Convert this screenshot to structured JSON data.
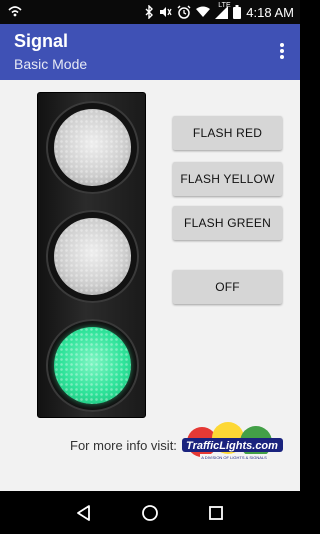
{
  "status_bar": {
    "time": "4:18 AM",
    "network_label": "LTE",
    "icons": [
      "notification-icon",
      "bluetooth-icon",
      "mute-icon",
      "alarm-icon",
      "wifi-icon",
      "cellular-signal-icon",
      "battery-icon"
    ]
  },
  "app_bar": {
    "title": "Signal",
    "subtitle": "Basic Mode",
    "menu_icon": "overflow-menu-icon",
    "color": "#3f51b5"
  },
  "signal": {
    "lamps": [
      {
        "position": "top",
        "state": "off"
      },
      {
        "position": "middle",
        "state": "off"
      },
      {
        "position": "bottom",
        "state": "on",
        "color": "#2fe39a"
      }
    ]
  },
  "buttons": {
    "flash_red": "FLASH RED",
    "flash_yellow": "FLASH YELLOW",
    "flash_green": "FLASH GREEN",
    "off": "OFF"
  },
  "footer": {
    "info_text": "For more info visit:",
    "logo_text": "TrafficLights.com",
    "logo_tagline": "A DIVISION OF LIGHTS & SIGNALS"
  },
  "nav_bar": {
    "icons": [
      "back-icon",
      "home-icon",
      "recents-icon"
    ]
  }
}
